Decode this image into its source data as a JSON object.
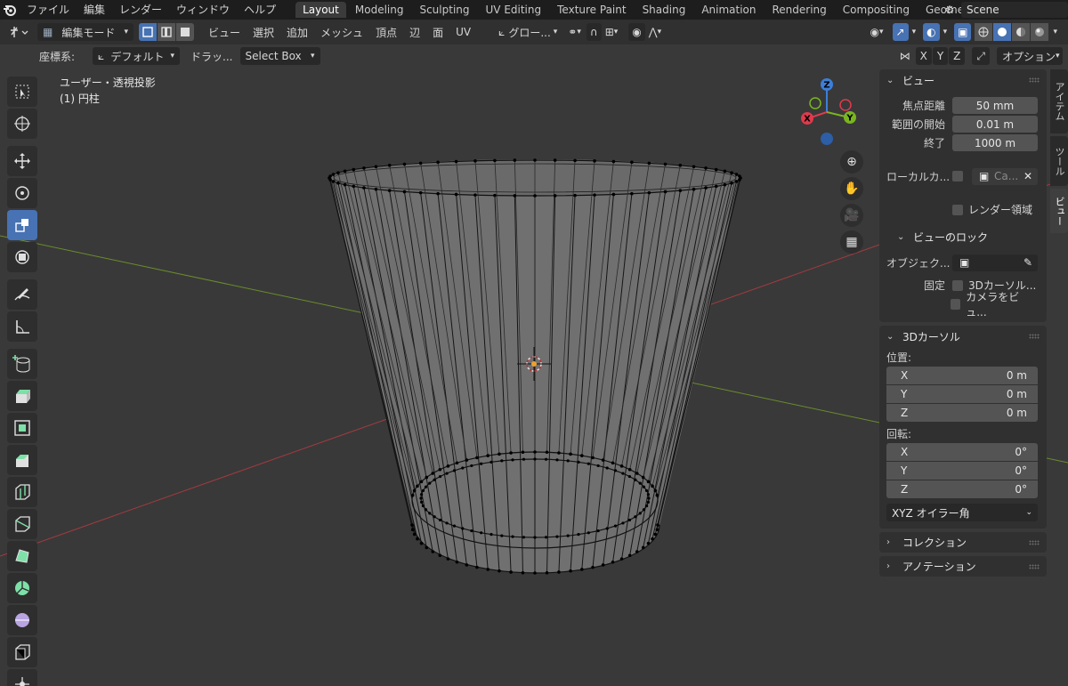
{
  "menubar": {
    "menus": [
      "ファイル",
      "編集",
      "レンダー",
      "ウィンドウ",
      "ヘルプ"
    ],
    "workspaces": [
      {
        "label": "Layout",
        "active": true
      },
      {
        "label": "Modeling",
        "active": false
      },
      {
        "label": "Sculpting",
        "active": false
      },
      {
        "label": "UV Editing",
        "active": false
      },
      {
        "label": "Texture Paint",
        "active": false
      },
      {
        "label": "Shading",
        "active": false
      },
      {
        "label": "Animation",
        "active": false
      },
      {
        "label": "Rendering",
        "active": false
      },
      {
        "label": "Compositing",
        "active": false
      },
      {
        "label": "Geometry",
        "active": false
      }
    ],
    "scene_name": "Scene"
  },
  "header": {
    "mode": "編集モード",
    "menus": [
      "ビュー",
      "選択",
      "追加",
      "メッシュ",
      "頂点",
      "辺",
      "面",
      "UV"
    ],
    "orientation": "グロー...",
    "coord_label": "座標系:",
    "coord_value": "デフォルト",
    "drag_label": "ドラッ...",
    "drag_value": "Select Box",
    "axes": [
      "X",
      "Y",
      "Z"
    ],
    "options": "オプション"
  },
  "viewport": {
    "view_name": "ユーザー・透視投影",
    "object_name": "(1) 円柱",
    "colors": {
      "x_axis": "#a33a3f",
      "y_axis": "#6a8d2c",
      "active_tool": "#4772b3",
      "vertex": "#000000"
    }
  },
  "gizmo": {
    "x": "X",
    "y": "Y",
    "z": "Z"
  },
  "npanel": {
    "view": {
      "title": "ビュー",
      "focal_label": "焦点距離",
      "focal_value": "50 mm",
      "clip_start_label": "範囲の開始",
      "clip_start_value": "0.01 m",
      "clip_end_label": "終了",
      "clip_end_value": "1000 m",
      "local_camera_label": "ローカルカ...",
      "local_camera_value": "Ca...",
      "render_region_label": "レンダー領域"
    },
    "view_lock": {
      "title": "ビューのロック",
      "object_label": "オブジェク...",
      "lock_label": "固定",
      "lock_cursor": "3Dカーソル...",
      "lock_camera": "カメラをビュ..."
    },
    "cursor": {
      "title": "3Dカーソル",
      "location_label": "位置:",
      "location": [
        {
          "axis": "X",
          "value": "0 m"
        },
        {
          "axis": "Y",
          "value": "0 m"
        },
        {
          "axis": "Z",
          "value": "0 m"
        }
      ],
      "rotation_label": "回転:",
      "rotation": [
        {
          "axis": "X",
          "value": "0°"
        },
        {
          "axis": "Y",
          "value": "0°"
        },
        {
          "axis": "Z",
          "value": "0°"
        }
      ],
      "rotation_mode": "XYZ オイラー角"
    },
    "collection": {
      "title": "コレクション"
    },
    "annotation": {
      "title": "アノテーション"
    }
  },
  "sidetabs": [
    "アイテム",
    "ツール",
    "ビュー"
  ]
}
